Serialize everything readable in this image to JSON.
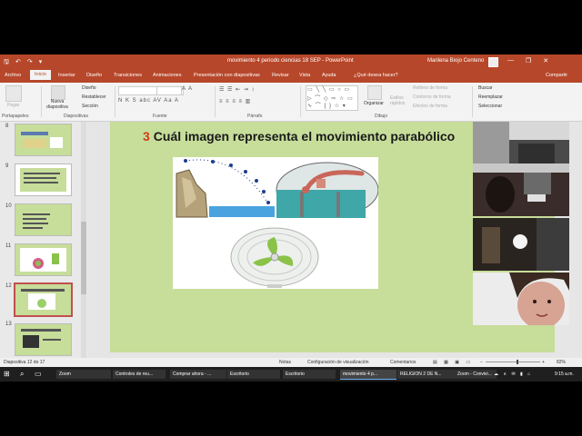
{
  "window": {
    "title": "movimiento 4 periodo ciencias 18 SEP  -  PowerPoint",
    "user": "Marilena Biojo Centeno",
    "minimize": "—",
    "restore": "❐",
    "close": "✕"
  },
  "qat": {
    "save": "🖫",
    "undo": "↶",
    "redo": "↷",
    "more": "▾"
  },
  "tabs": [
    "Archivo",
    "Inicio",
    "Insertar",
    "Diseño",
    "Transiciones",
    "Animaciones",
    "Presentación con diapositivas",
    "Revisar",
    "Vista",
    "Ayuda",
    "¿Qué desea hacer?"
  ],
  "share_label": "Compartir",
  "ribbon": {
    "groups": [
      "Portapapeles",
      "Diapositivas",
      "Fuente",
      "Párrafo",
      "Dibujo"
    ],
    "pegar": "Pegar",
    "nueva_diapositiva": "Nueva diapositiva",
    "diseno": "Diseño",
    "restablecer": "Restablecer",
    "seccion": "Sección",
    "organizar": "Organizar",
    "estilos_rapidos": "Estilos rápidos",
    "relleno": "Relleno de forma",
    "contorno": "Contorno de forma",
    "efectos": "Efectos de forma",
    "buscar": "Buscar",
    "reemplazar": "Reemplazar",
    "seleccionar": "Seleccionar"
  },
  "thumbnails": [
    {
      "num": "8",
      "selected": false
    },
    {
      "num": "9",
      "selected": false
    },
    {
      "num": "10",
      "selected": false
    },
    {
      "num": "11",
      "selected": false
    },
    {
      "num": "12",
      "selected": true
    },
    {
      "num": "13",
      "selected": false
    }
  ],
  "slide": {
    "number": "3",
    "question": "Cuál imagen representa el movimiento parabólico"
  },
  "statusbar": {
    "slide_info": "Diapositiva 12 de 17",
    "notas": "Notas",
    "config": "Configuración de visualización",
    "comentarios": "Comentarios",
    "zoom": "82%"
  },
  "taskbar": {
    "items": [
      "Zoom",
      "Controles de reu...",
      "Comprar ahora - ...",
      "Escritorio",
      "Escritorio",
      "movimiento 4 p...",
      "RELIGION 2 DE N...",
      "Zoom - Convivi..."
    ],
    "active_index": 5,
    "clock": "9:15 a.m."
  },
  "colors": {
    "powerpoint_accent": "#b7472a",
    "slide_background": "#c7dd9a",
    "question_number": "#d03a1a"
  }
}
